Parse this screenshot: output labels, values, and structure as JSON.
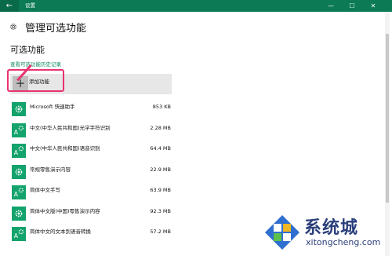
{
  "window": {
    "title": "设置",
    "controls": {
      "minimize": "—",
      "maximize": "☐",
      "close": "✕"
    }
  },
  "header": {
    "title": "管理可选功能"
  },
  "section": {
    "title": "可选功能",
    "history_link": "查看可选功能历史记录",
    "add_button": {
      "plus": "+",
      "label": "添加功能"
    }
  },
  "features": [
    {
      "name": "Microsoft 快速助手",
      "size": "853 KB",
      "icon": "gear-icon"
    },
    {
      "name": "中文(中华人民共和国)光学字符识别",
      "size": "2.28 MB",
      "icon": "gear-text-icon"
    },
    {
      "name": "中文(中华人民共和国)语音识别",
      "size": "64.4 MB",
      "icon": "gear-text-icon"
    },
    {
      "name": "常规零售演示内容",
      "size": "22.9 MB",
      "icon": "gear-icon"
    },
    {
      "name": "简体中文手写",
      "size": "63.9 MB",
      "icon": "gear-text-icon"
    },
    {
      "name": "简体中文版(中国)零售演示内容",
      "size": "92.3 MB",
      "icon": "gear-icon"
    },
    {
      "name": "简体中文的文本到语音转换",
      "size": "57.2 MB",
      "icon": "gear-text-icon"
    }
  ],
  "watermark": {
    "brand": "系统城",
    "domain": "xitongcheng.com"
  },
  "colors": {
    "titlebar": "#0b7a55",
    "accent": "#13a36c",
    "link": "#0f8a5f",
    "highlight": "#e8336f"
  }
}
